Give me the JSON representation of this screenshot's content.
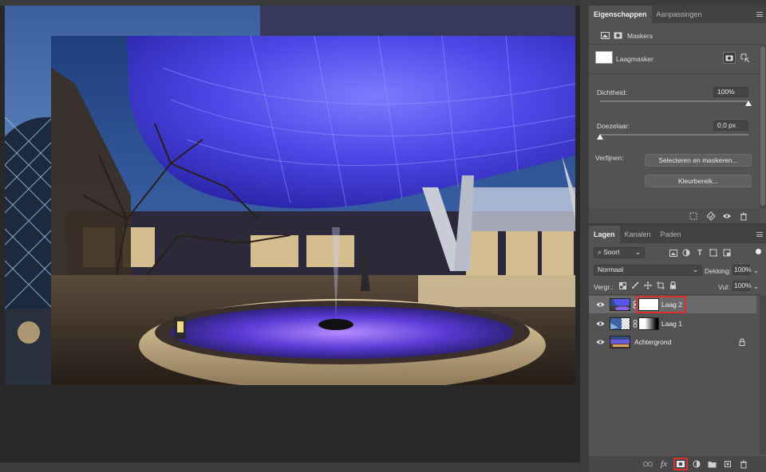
{
  "properties_panel": {
    "tabs": [
      {
        "label": "Eigenschappen",
        "active": true
      },
      {
        "label": "Aanpassingen",
        "active": false
      }
    ],
    "section_label": "Maskers",
    "mask_label": "Laagmasker",
    "density_label": "Dichtheid:",
    "density_value": "100%",
    "density_fraction": 1.0,
    "feather_label": "Doezelaar:",
    "feather_value": "0,0 px",
    "feather_fraction": 0.0,
    "refine_label": "Verfijnen:",
    "select_and_mask_button": "Selecteren en maskeren...",
    "color_range_button": "Kleurbereik..."
  },
  "layers_panel": {
    "tabs": [
      {
        "label": "Lagen",
        "active": true
      },
      {
        "label": "Kanalen",
        "active": false
      },
      {
        "label": "Paden",
        "active": false
      }
    ],
    "filter_kind": "Soort",
    "blend_mode": "Normaal",
    "opacity_label": "Dekking:",
    "opacity_value": "100%",
    "lock_label": "Vergr.:",
    "fill_label": "Vul:",
    "fill_value": "100%",
    "layers": [
      {
        "name": "Laag 2",
        "selected": true,
        "has_mask": true
      },
      {
        "name": "Laag 1",
        "selected": false,
        "has_mask": true
      },
      {
        "name": "Achtergrond",
        "selected": false,
        "has_mask": false,
        "locked": true
      }
    ],
    "bottom_fx_label": "fx"
  },
  "colors": {
    "panel_bg": "#535353",
    "tab_bg": "#424242",
    "selected_layer": "#6a6a6a",
    "highlight_red": "#d9302b",
    "canvas_bg": "#282828"
  }
}
